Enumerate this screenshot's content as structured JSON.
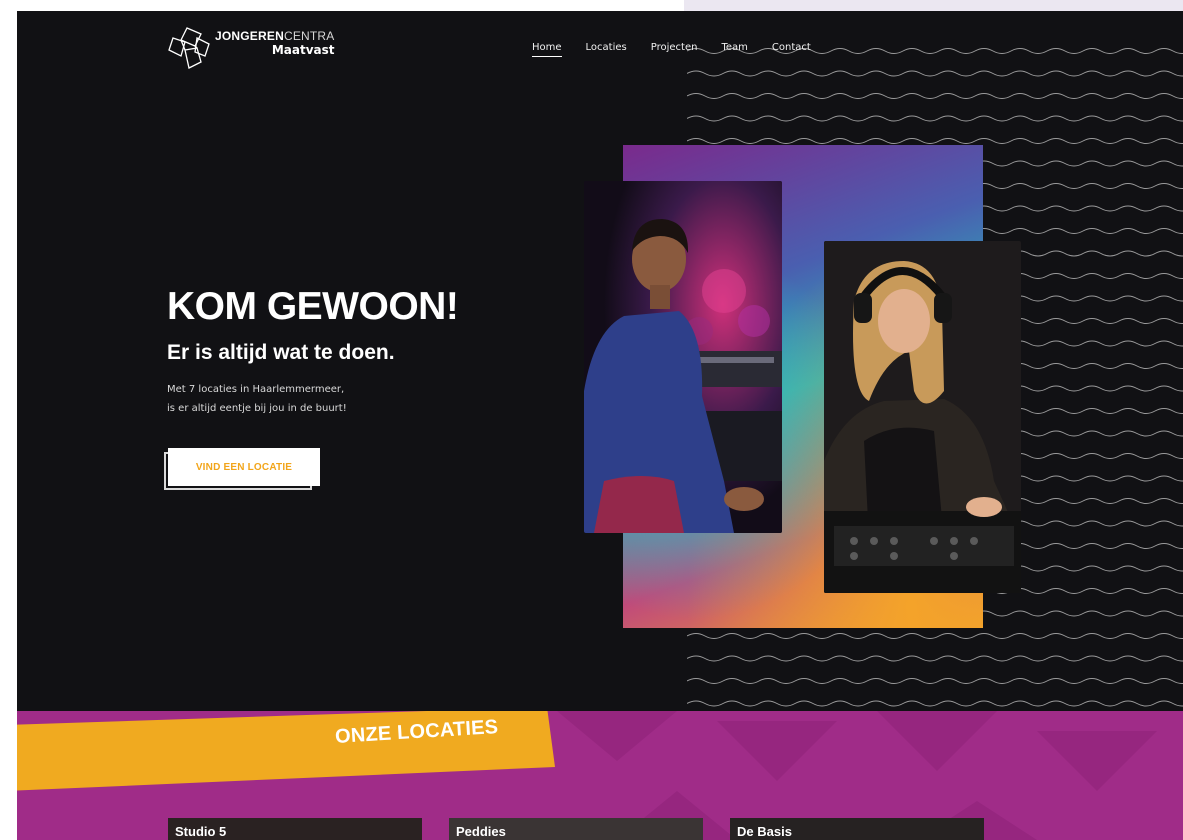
{
  "brand": {
    "line1_bold": "JONGEREN",
    "line1_light": "CENTRA",
    "line2": "Maatvast"
  },
  "nav": {
    "items": [
      {
        "label": "Home",
        "active": true
      },
      {
        "label": "Locaties",
        "active": false
      },
      {
        "label": "Projecten",
        "active": false
      },
      {
        "label": "Team",
        "active": false
      },
      {
        "label": "Contact",
        "active": false
      }
    ]
  },
  "hero": {
    "title": "KOM GEWOON!",
    "subtitle": "Er is altijd wat te doen.",
    "body_line1": "Met 7 locaties in Haarlemmermeer,",
    "body_line2": "is er altijd eentje bij jou in de buurt!",
    "cta_label": "VIND EEN LOCATIE"
  },
  "locations": {
    "title": "ONZE LOCATIES",
    "cards": [
      {
        "name": "Studio 5"
      },
      {
        "name": "Peddies"
      },
      {
        "name": "De Basis"
      }
    ]
  },
  "colors": {
    "background": "#111114",
    "accent_orange": "#f2a51a",
    "locations_magenta": "#a02c88",
    "text_light": "#ffffff"
  }
}
